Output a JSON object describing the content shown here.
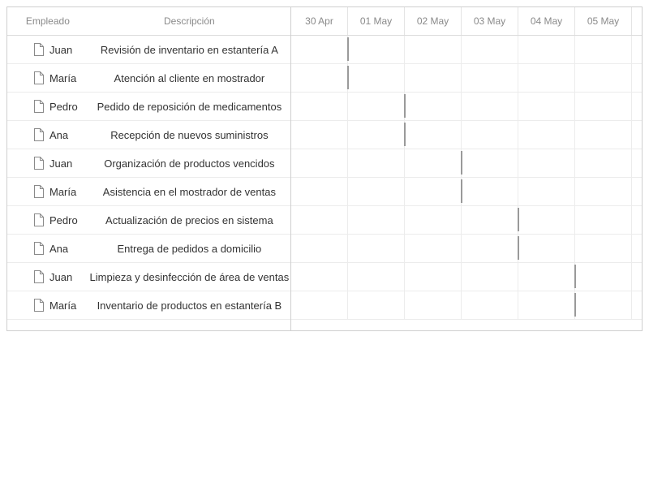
{
  "grid": {
    "headers": {
      "employee": "Empleado",
      "description": "Descripción"
    },
    "rows": [
      {
        "employee": "Juan",
        "description": "Revisión de inventario en estantería A",
        "date": "30 Apr"
      },
      {
        "employee": "María",
        "description": "Atención al cliente en mostrador",
        "date": "30 Apr"
      },
      {
        "employee": "Pedro",
        "description": "Pedido de reposición de medicamentos",
        "date": "01 May"
      },
      {
        "employee": "Ana",
        "description": "Recepción de nuevos suministros",
        "date": "01 May"
      },
      {
        "employee": "Juan",
        "description": "Organización de productos vencidos",
        "date": "02 May"
      },
      {
        "employee": "María",
        "description": "Asistencia en el mostrador de ventas",
        "date": "02 May"
      },
      {
        "employee": "Pedro",
        "description": "Actualización de precios en sistema",
        "date": "03 May"
      },
      {
        "employee": "Ana",
        "description": "Entrega de pedidos a domicilio",
        "date": "03 May"
      },
      {
        "employee": "Juan",
        "description": "Limpieza y desinfección de área de ventas",
        "date": "04 May"
      },
      {
        "employee": "María",
        "description": "Inventario de productos en estantería B",
        "date": "04 May"
      }
    ]
  },
  "timeline": {
    "days": [
      "30 Apr",
      "01 May",
      "02 May",
      "03 May",
      "04 May",
      "05 May"
    ]
  },
  "colors": {
    "task_marker": "#9a9a9a",
    "border": "#cfcfcf",
    "header_text": "#8a8a8a"
  },
  "icons": {
    "row_icon": "file-icon"
  }
}
